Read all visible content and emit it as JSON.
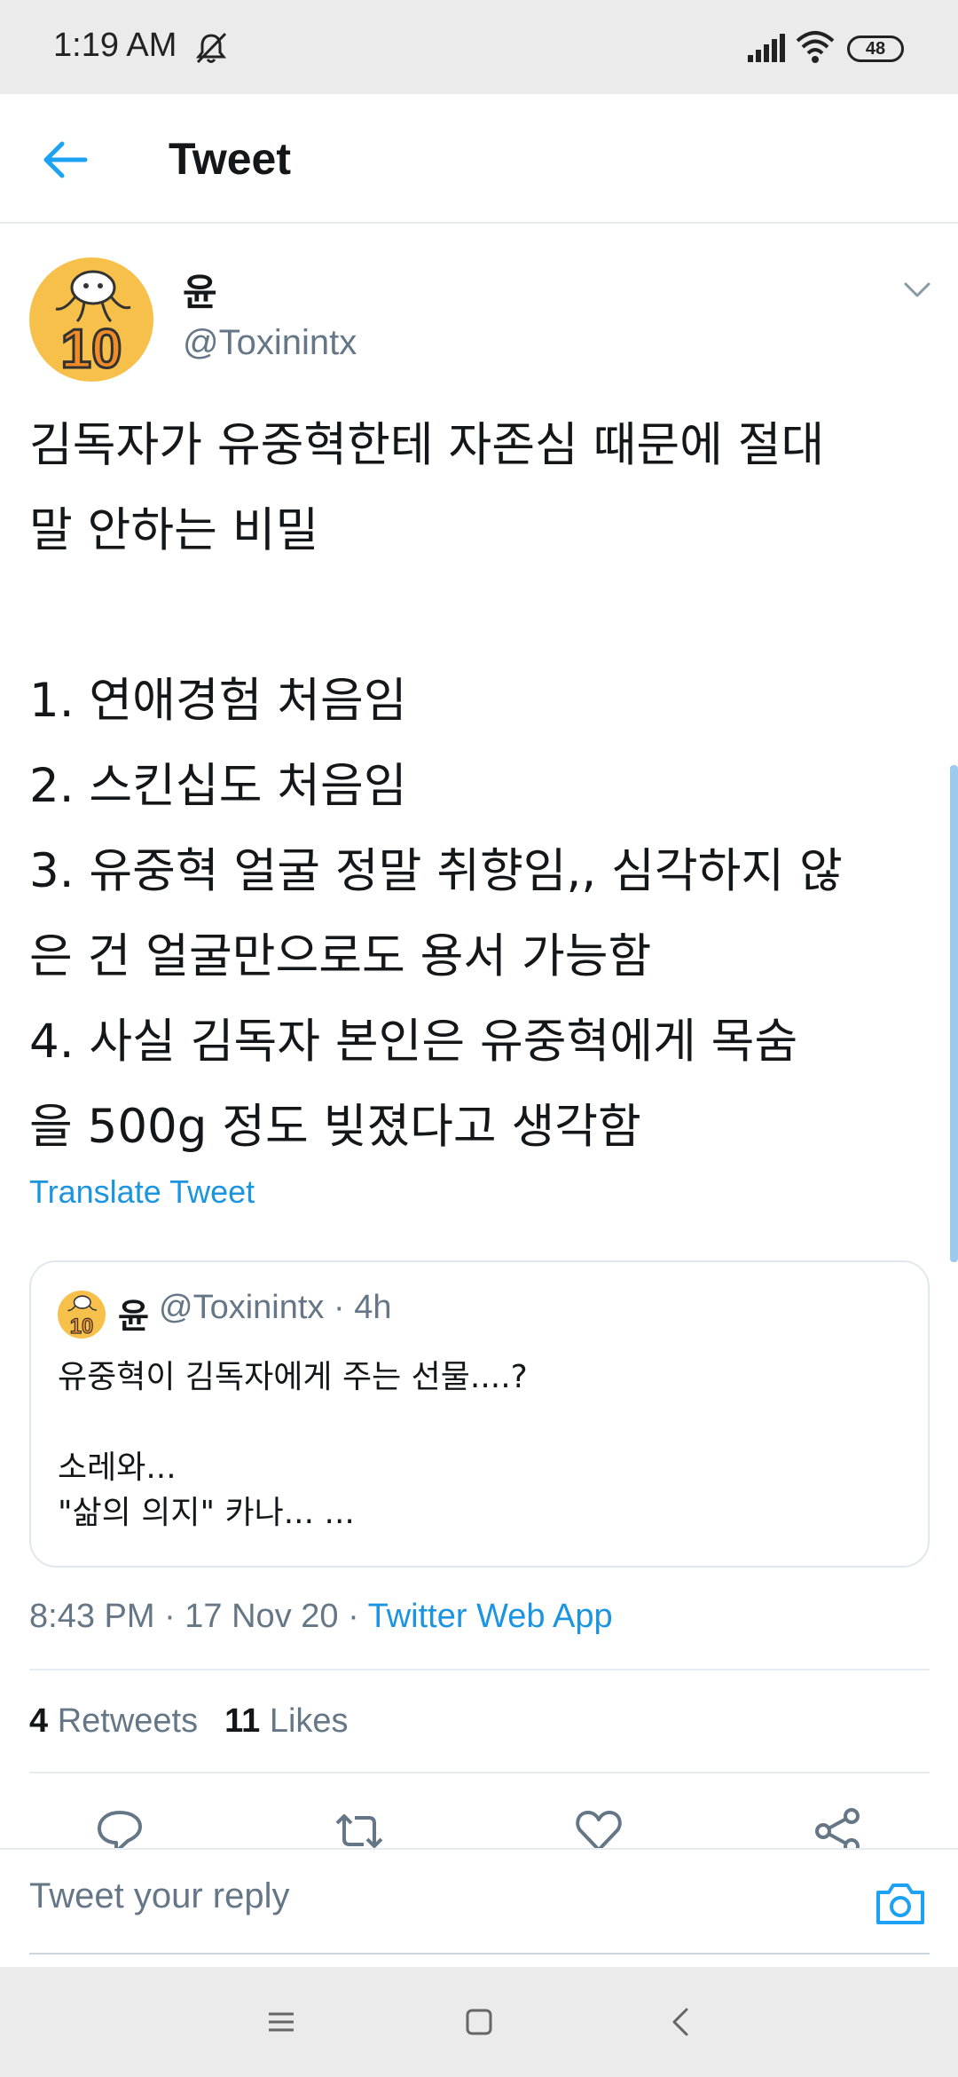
{
  "status_bar": {
    "time": "1:19 AM",
    "battery": "48"
  },
  "header": {
    "title": "Tweet"
  },
  "tweet": {
    "display_name": "윤",
    "handle": "@Toxinintx",
    "avatar_badge": "10",
    "body": "김독자가 유중혁한테 자존심 때문에 절대\n말 안하는 비밀\n\n1. 연애경험 처음임\n2. 스킨십도 처음임\n3. 유중혁 얼굴 정말 취향임,, 심각하지 않\n은 건 얼굴만으로도 용서 가능함\n4. 사실 김독자 본인은 유중혁에게 목숨\n을 500g 정도 빚졌다고 생각함",
    "translate_label": "Translate Tweet",
    "timestamp": "8:43 PM · 17 Nov 20 · ",
    "source": "Twitter Web App",
    "retweets_count": "4",
    "retweets_label": "Retweets",
    "likes_count": "11",
    "likes_label": "Likes"
  },
  "quoted_tweet": {
    "display_name": "윤",
    "handle_time": "@Toxinintx · 4h",
    "text": "유중혁이 김독자에게 주는 선물....?\n\n소레와...\n\"삶의 의지\" 카나... ..."
  },
  "reply": {
    "placeholder": "Tweet your reply"
  },
  "colors": {
    "accent": "#1b95e0",
    "secondary_text": "#657786",
    "avatar_bg": "#f6c04a"
  },
  "icons": {
    "actions": [
      "reply-icon",
      "retweet-icon",
      "like-icon",
      "share-icon"
    ],
    "nav": [
      "menu-icon",
      "home-icon",
      "back-nav-icon"
    ]
  }
}
